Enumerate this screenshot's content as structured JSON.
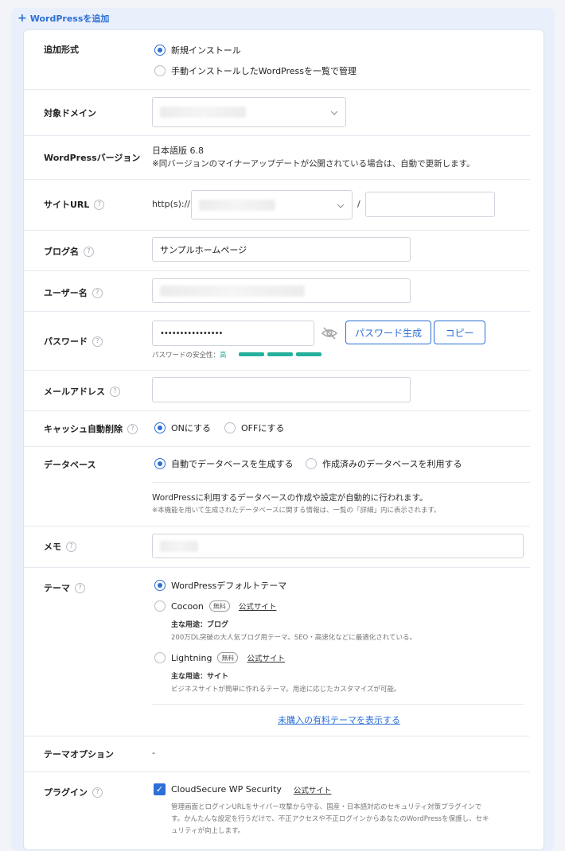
{
  "header": {
    "add_label": "WordPressを追加"
  },
  "add_type": {
    "label": "追加形式",
    "options": [
      "新規インストール",
      "手動インストールしたWordPressを一覧で管理"
    ]
  },
  "domain": {
    "label": "対象ドメイン"
  },
  "version": {
    "label": "WordPressバージョン",
    "value": "日本語版 6.8",
    "note": "※同バージョンのマイナーアップデートが公開されている場合は、自動で更新します。"
  },
  "site_url": {
    "label": "サイトURL",
    "prefix": "http(s)://",
    "slash": "/"
  },
  "blog_name": {
    "label": "ブログ名",
    "value": "サンプルホームページ"
  },
  "username": {
    "label": "ユーザー名"
  },
  "password": {
    "label": "パスワード",
    "value": "••••••••••••••••",
    "generate": "パスワード生成",
    "copy": "コピー",
    "strength_label": "パスワードの安全性：",
    "strength_value": "高"
  },
  "email": {
    "label": "メールアドレス"
  },
  "cache": {
    "label": "キャッシュ自動削除",
    "options": [
      "ONにする",
      "OFFにする"
    ]
  },
  "database": {
    "label": "データベース",
    "options": [
      "自動でデータベースを生成する",
      "作成済みのデータベースを利用する"
    ],
    "desc": "WordPressに利用するデータベースの作成や設定が自動的に行われます。",
    "note": "※本機能を用いて生成されたデータベースに関する情報は、一覧の「詳細」内に表示されます。"
  },
  "memo": {
    "label": "メモ"
  },
  "theme": {
    "label": "テーマ",
    "default": "WordPressデフォルトテーマ",
    "items": [
      {
        "name": "Cocoon",
        "badge": "無料",
        "link": "公式サイト",
        "use_label": "主な用途：ブログ",
        "desc": "200万DL突破の大人気ブログ用テーマ。SEO・高速化などに最適化されている。"
      },
      {
        "name": "Lightning",
        "badge": "無料",
        "link": "公式サイト",
        "use_label": "主な用途：サイト",
        "desc": "ビジネスサイトが簡単に作れるテーマ。用途に応じたカスタマイズが可能。"
      }
    ],
    "paid_link": "未購入の有料テーマを表示する"
  },
  "theme_option": {
    "label": "テーマオプション",
    "value": "-"
  },
  "plugin": {
    "label": "プラグイン",
    "name": "CloudSecure WP Security",
    "link": "公式サイト",
    "desc1": "管理画面とログインURLをサイバー攻撃から守る、国産・日本語対応のセキュリティ対策プラグインで",
    "desc2": "す。かんたんな設定を行うだけで、不正アクセスや不正ログインからあなたのWordPressを保護し、セキ",
    "desc3": "ュリティが向上します。"
  },
  "colors": {
    "accent": "#2c6fd6",
    "strength": "#25b09b"
  }
}
